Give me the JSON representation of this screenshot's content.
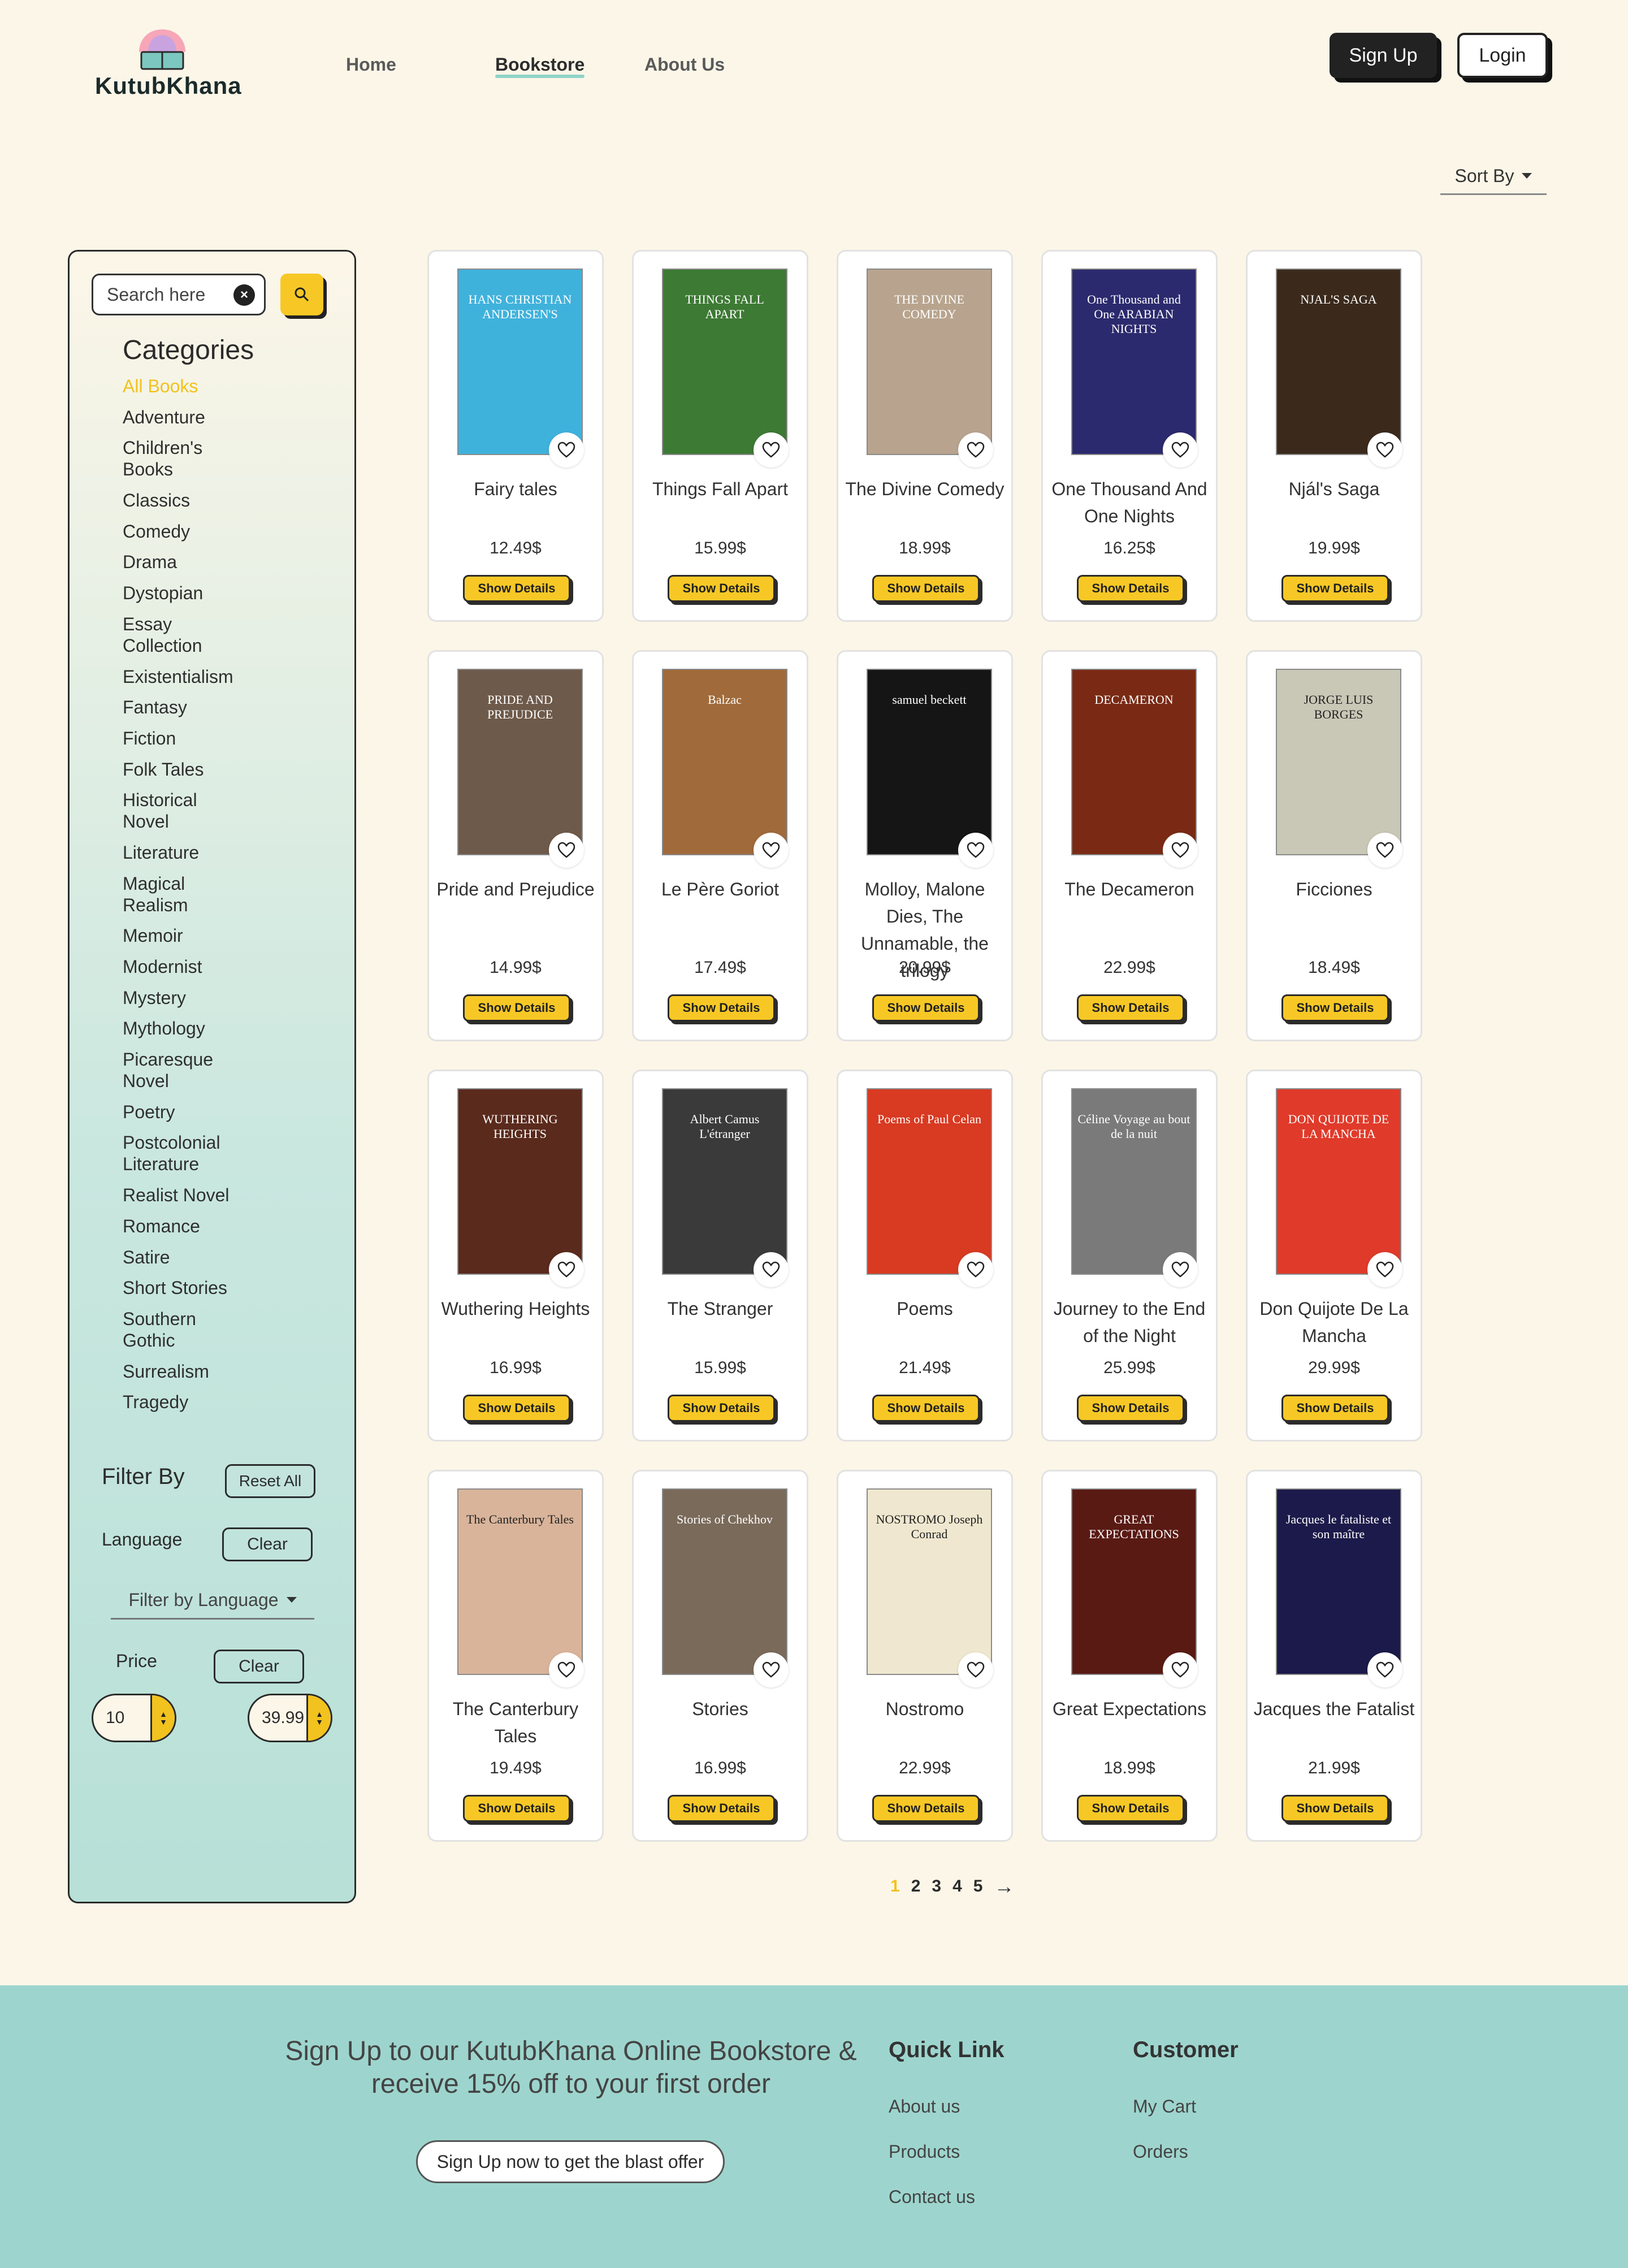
{
  "brand": {
    "name": "KutubKhana"
  },
  "nav": {
    "home": "Home",
    "bookstore": "Bookstore",
    "about": "About Us"
  },
  "auth": {
    "signup": "Sign Up",
    "login": "Login"
  },
  "sort": {
    "label": "Sort By"
  },
  "search": {
    "placeholder": "Search here"
  },
  "categories": {
    "title": "Categories",
    "items": [
      "All Books",
      "Adventure",
      "Children's Books",
      "Classics",
      "Comedy",
      "Drama",
      "Dystopian",
      "Essay Collection",
      "Existentialism",
      "Fantasy",
      "Fiction",
      "Folk Tales",
      "Historical Novel",
      "Literature",
      "Magical Realism",
      "Memoir",
      "Modernist",
      "Mystery",
      "Mythology",
      "Picaresque Novel",
      "Poetry",
      "Postcolonial Literature",
      "Realist Novel",
      "Romance",
      "Satire",
      "Short Stories",
      "Southern Gothic",
      "Surrealism",
      "Tragedy"
    ],
    "active": "All Books"
  },
  "filters": {
    "title": "Filter By",
    "reset": "Reset All",
    "language_label": "Language",
    "clear": "Clear",
    "language_placeholder": "Filter by Language",
    "price_label": "Price",
    "price_min": "10",
    "price_max": "39.99"
  },
  "book_card": {
    "details_label": "Show Details"
  },
  "books": [
    {
      "title": "Fairy tales",
      "price": "12.49$",
      "cover_color": "#3fb2dc",
      "cover_text": "HANS CHRISTIAN ANDERSEN'S"
    },
    {
      "title": "Things Fall Apart",
      "price": "15.99$",
      "cover_color": "#3d7a34",
      "cover_text": "THINGS FALL APART"
    },
    {
      "title": "The Divine Comedy",
      "price": "18.99$",
      "cover_color": "#b8a48e",
      "cover_text": "THE DIVINE COMEDY"
    },
    {
      "title": "One Thousand And One Nights",
      "price": "16.25$",
      "cover_color": "#2c2a6e",
      "cover_text": "One Thousand and One ARABIAN NIGHTS"
    },
    {
      "title": "Njál's Saga",
      "price": "19.99$",
      "cover_color": "#3b2a1c",
      "cover_text": "NJAL'S SAGA"
    },
    {
      "title": "Pride and Prejudice",
      "price": "14.99$",
      "cover_color": "#6e5a4a",
      "cover_text": "PRIDE AND PREJUDICE"
    },
    {
      "title": "Le Père Goriot",
      "price": "17.49$",
      "cover_color": "#a06a3a",
      "cover_text": "Balzac"
    },
    {
      "title": "Molloy, Malone Dies, The Unnamable, the trilogy",
      "price": "20.99$",
      "cover_color": "#151515",
      "cover_text": "samuel beckett"
    },
    {
      "title": "The Decameron",
      "price": "22.99$",
      "cover_color": "#7a2a14",
      "cover_text": "DECAMERON"
    },
    {
      "title": "Ficciones",
      "price": "18.49$",
      "cover_color": "#c9c7b6",
      "cover_text": "JORGE LUIS BORGES"
    },
    {
      "title": "Wuthering Heights",
      "price": "16.99$",
      "cover_color": "#5a2a1c",
      "cover_text": "WUTHERING HEIGHTS"
    },
    {
      "title": "The Stranger",
      "price": "15.99$",
      "cover_color": "#3a3a3a",
      "cover_text": "Albert Camus L'étranger"
    },
    {
      "title": "Poems",
      "price": "21.49$",
      "cover_color": "#d83a22",
      "cover_text": "Poems of Paul Celan"
    },
    {
      "title": "Journey to the End of the Night",
      "price": "25.99$",
      "cover_color": "#7a7a7a",
      "cover_text": "Céline Voyage au bout de la nuit"
    },
    {
      "title": "Don Quijote De La Mancha",
      "price": "29.99$",
      "cover_color": "#e03a2a",
      "cover_text": "DON QUIJOTE DE LA MANCHA"
    },
    {
      "title": "The Canterbury Tales",
      "price": "19.49$",
      "cover_color": "#d9b49a",
      "cover_text": "The Canterbury Tales"
    },
    {
      "title": "Stories",
      "price": "16.99$",
      "cover_color": "#7a6a5a",
      "cover_text": "Stories of Chekhov"
    },
    {
      "title": "Nostromo",
      "price": "22.99$",
      "cover_color": "#efe7cf",
      "cover_text": "NOSTROMO Joseph Conrad"
    },
    {
      "title": "Great Expectations",
      "price": "18.99$",
      "cover_color": "#5a1a14",
      "cover_text": "GREAT EXPECTATIONS"
    },
    {
      "title": "Jacques the Fatalist",
      "price": "21.99$",
      "cover_color": "#1c1a4a",
      "cover_text": "Jacques le fataliste et son maître"
    }
  ],
  "pagination": {
    "pages": [
      "1",
      "2",
      "3",
      "4",
      "5"
    ],
    "current": "1",
    "next": "→"
  },
  "footer": {
    "promo": "Sign Up to our KutubKhana Online Bookstore & receive 15% off to your first order",
    "cta": "Sign Up now to get the blast offer",
    "quick_link_title": "Quick Link",
    "quick_links": [
      "About us",
      "Products",
      "Contact us"
    ],
    "customer_title": "Customer",
    "customer_links": [
      "My Cart",
      "Orders"
    ]
  }
}
